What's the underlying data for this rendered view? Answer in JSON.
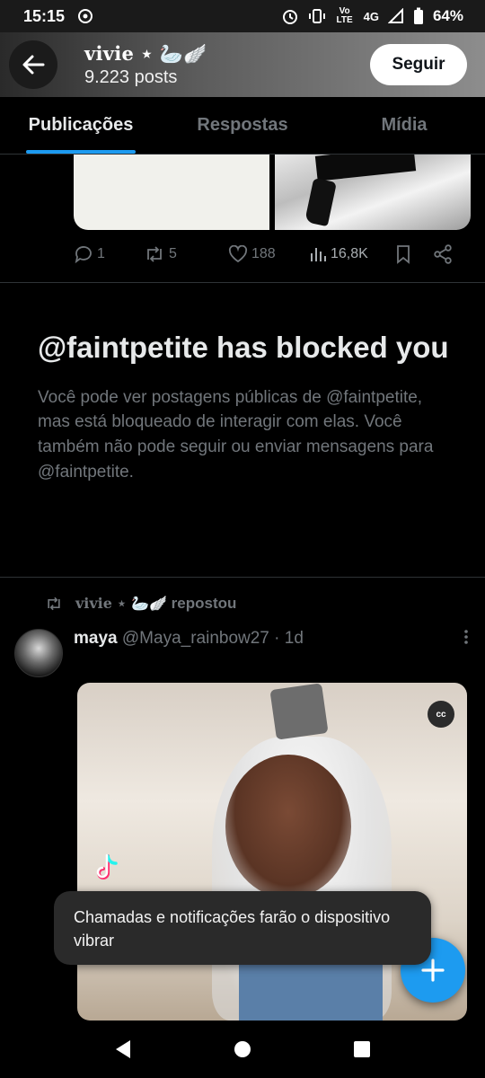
{
  "status_bar": {
    "time": "15:15",
    "network": "4G",
    "battery": "64%",
    "volte": "Vo LTE"
  },
  "header": {
    "display_name": "vivie ⋆ 🦢🪽",
    "post_count": "9.223 posts",
    "follow_label": "Seguir"
  },
  "tabs": [
    {
      "label": "Publicações",
      "active": true
    },
    {
      "label": "Respostas",
      "active": false
    },
    {
      "label": "Mídia",
      "active": false
    }
  ],
  "previous_post": {
    "replies": "1",
    "reposts": "5",
    "likes": "188",
    "views": "16,8K"
  },
  "blocked_notice": {
    "title": "@faintpetite has blocked you",
    "description": "Você pode ver postagens públicas de @faintpetite, mas está bloqueado de interagir com elas. Você também não pode seguir ou enviar mensagens para @faintpetite."
  },
  "repost": {
    "reposter": "vivie ⋆ 🦢🪽",
    "label": "repostou"
  },
  "tweet": {
    "author_name": "maya",
    "author_handle": "@Maya_rainbow27 · 1d",
    "cc_label": "cc"
  },
  "toast": {
    "message": "Chamadas e notificações farão o dispositivo vibrar"
  },
  "colors": {
    "accent": "#1d9bf0",
    "muted": "#71767b",
    "text": "#e7e9ea",
    "background": "#000000"
  }
}
